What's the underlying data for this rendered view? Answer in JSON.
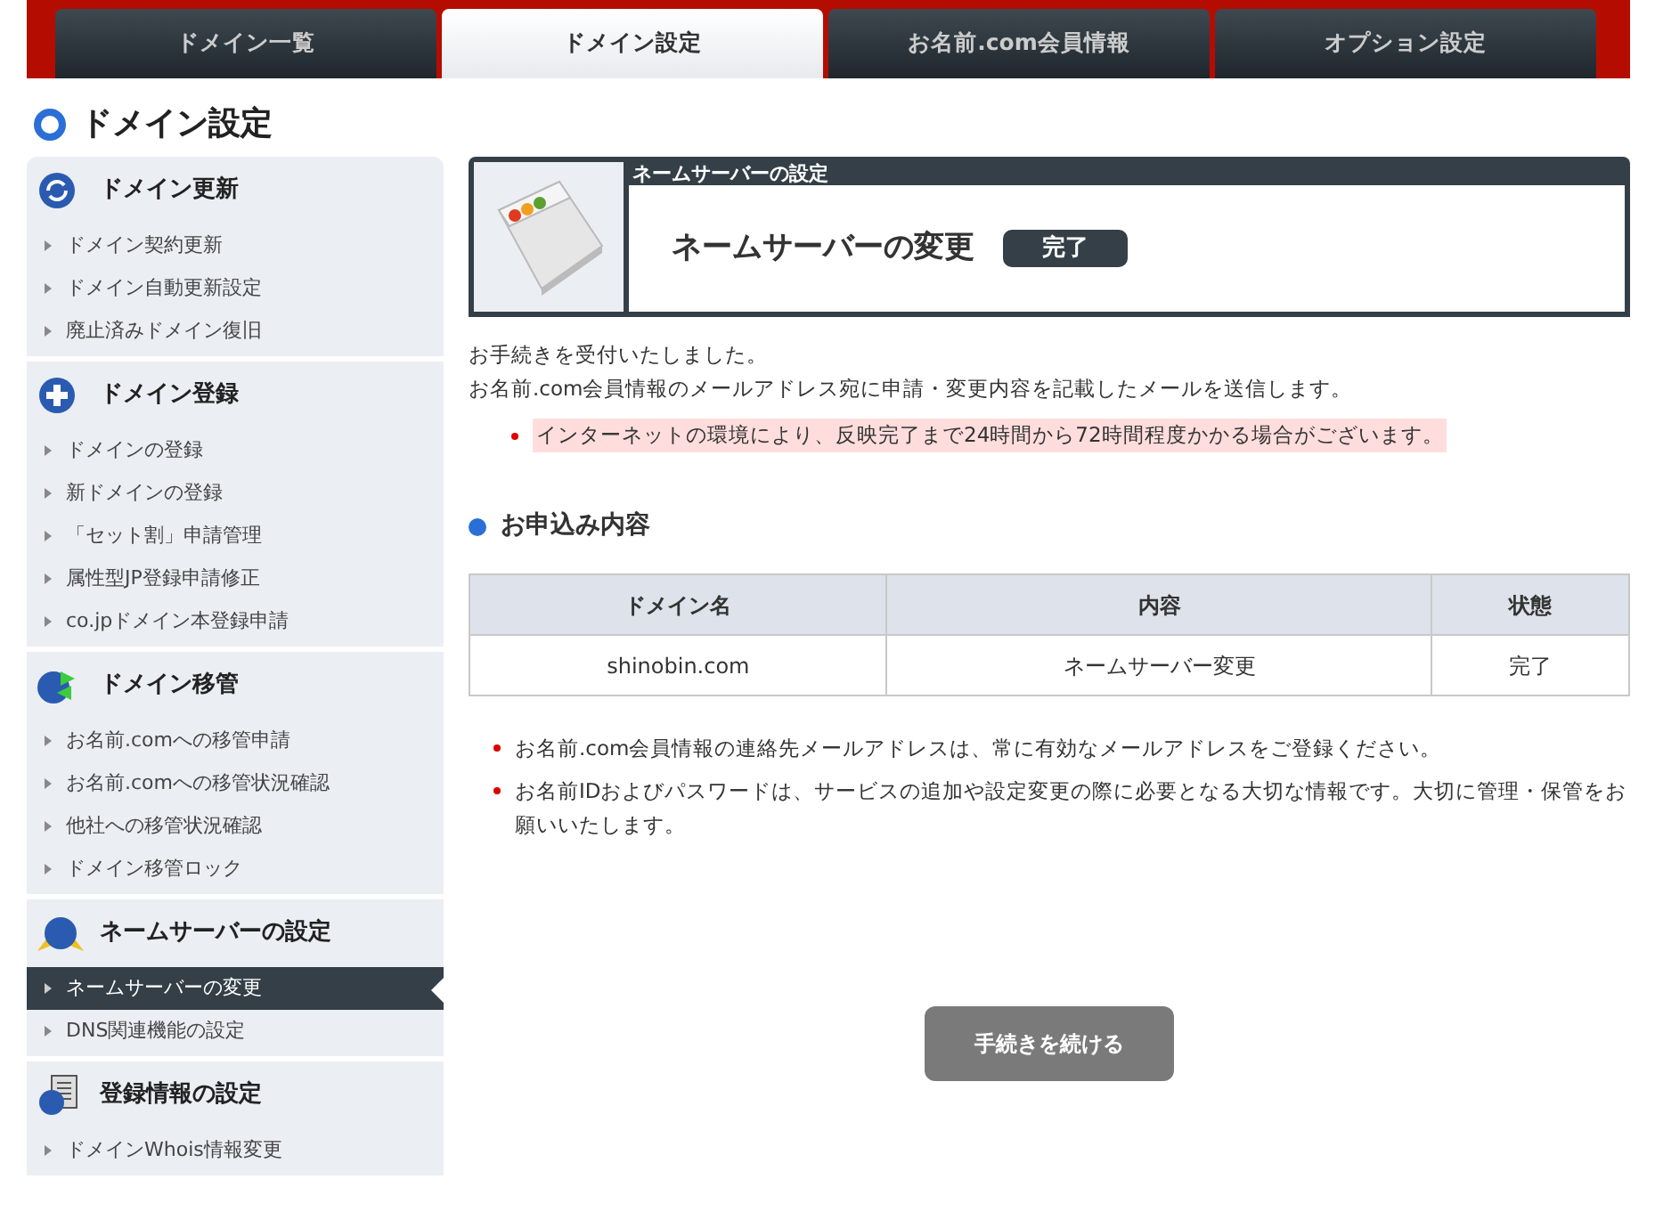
{
  "tabs": [
    {
      "label": "ドメイン一覧",
      "selected": false
    },
    {
      "label": "ドメイン設定",
      "selected": true
    },
    {
      "label": "お名前.com会員情報",
      "selected": false
    },
    {
      "label": "オプション設定",
      "selected": false
    }
  ],
  "page_title": "ドメイン設定",
  "sidebar": {
    "sections": [
      {
        "title": "ドメイン更新",
        "items": [
          {
            "label": "ドメイン契約更新",
            "selected": false
          },
          {
            "label": "ドメイン自動更新設定",
            "selected": false
          },
          {
            "label": "廃止済みドメイン復旧",
            "selected": false
          }
        ]
      },
      {
        "title": "ドメイン登録",
        "items": [
          {
            "label": "ドメインの登録",
            "selected": false
          },
          {
            "label": "新ドメインの登録",
            "selected": false
          },
          {
            "label": "「セット割」申請管理",
            "selected": false
          },
          {
            "label": "属性型JP登録申請修正",
            "selected": false
          },
          {
            "label": "co.jpドメイン本登録申請",
            "selected": false
          }
        ]
      },
      {
        "title": "ドメイン移管",
        "items": [
          {
            "label": "お名前.comへの移管申請",
            "selected": false
          },
          {
            "label": "お名前.comへの移管状況確認",
            "selected": false
          },
          {
            "label": "他社への移管状況確認",
            "selected": false
          },
          {
            "label": "ドメイン移管ロック",
            "selected": false
          }
        ]
      },
      {
        "title": "ネームサーバーの設定",
        "items": [
          {
            "label": "ネームサーバーの変更",
            "selected": true
          },
          {
            "label": "DNS関連機能の設定",
            "selected": false
          }
        ]
      },
      {
        "title": "登録情報の設定",
        "items": [
          {
            "label": "ドメインWhois情報変更",
            "selected": false
          }
        ]
      }
    ]
  },
  "header_panel": {
    "caption": "ネームサーバーの設定",
    "title": "ネームサーバーの変更",
    "status": "完了"
  },
  "messages": [
    "お手続きを受付いたしました。",
    "お名前.com会員情報のメールアドレス宛に申請・変更内容を記載したメールを送信します。"
  ],
  "notice": "インターネットの環境により、反映完了まで24時間から72時間程度かかる場合がございます。",
  "section_title": "お申込み内容",
  "table": {
    "columns": [
      "ドメイン名",
      "内容",
      "状態"
    ],
    "rows": [
      [
        "shinobin.com",
        "ネームサーバー変更",
        "完了"
      ]
    ]
  },
  "notes": [
    "お名前.com会員情報の連絡先メールアドレスは、常に有効なメールアドレスをご登録ください。",
    "お名前IDおよびパスワードは、サービスの追加や設定変更の際に必要となる大切な情報です。大切に管理・保管をお願いいたします。"
  ],
  "continue_button": "手続きを続ける"
}
